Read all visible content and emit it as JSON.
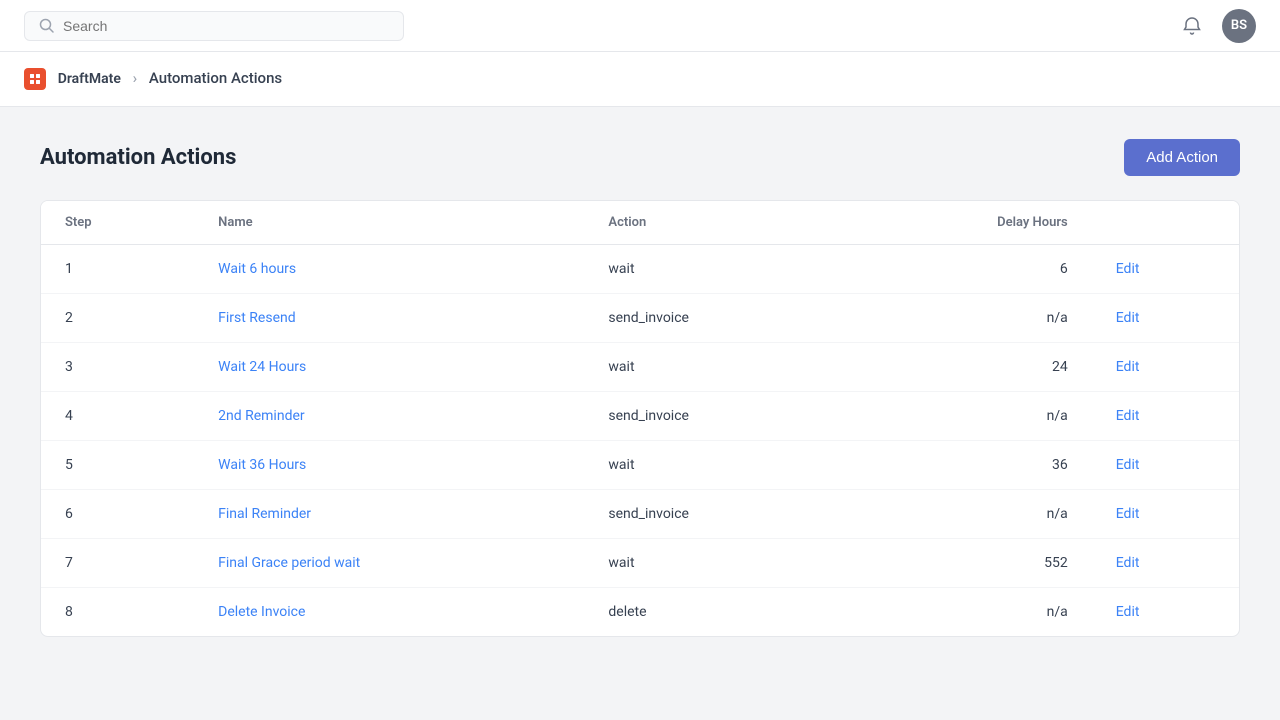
{
  "app": {
    "name": "DraftMate"
  },
  "nav": {
    "search_placeholder": "Search",
    "avatar_initials": "BS"
  },
  "breadcrumb": {
    "title": "Automation Actions"
  },
  "page": {
    "title": "Automation Actions",
    "add_button_label": "Add Action"
  },
  "table": {
    "columns": [
      {
        "key": "step",
        "label": "Step",
        "align": "left"
      },
      {
        "key": "name",
        "label": "Name",
        "align": "left"
      },
      {
        "key": "action",
        "label": "Action",
        "align": "left"
      },
      {
        "key": "delay_hours",
        "label": "Delay Hours",
        "align": "right"
      }
    ],
    "rows": [
      {
        "step": "1",
        "name": "Wait 6 hours",
        "action": "wait",
        "delay_hours": "6",
        "edit_label": "Edit"
      },
      {
        "step": "2",
        "name": "First Resend",
        "action": "send_invoice",
        "delay_hours": "n/a",
        "edit_label": "Edit"
      },
      {
        "step": "3",
        "name": "Wait 24 Hours",
        "action": "wait",
        "delay_hours": "24",
        "edit_label": "Edit"
      },
      {
        "step": "4",
        "name": "2nd Reminder",
        "action": "send_invoice",
        "delay_hours": "n/a",
        "edit_label": "Edit"
      },
      {
        "step": "5",
        "name": "Wait 36 Hours",
        "action": "wait",
        "delay_hours": "36",
        "edit_label": "Edit"
      },
      {
        "step": "6",
        "name": "Final Reminder",
        "action": "send_invoice",
        "delay_hours": "n/a",
        "edit_label": "Edit"
      },
      {
        "step": "7",
        "name": "Final Grace period wait",
        "action": "wait",
        "delay_hours": "552",
        "edit_label": "Edit"
      },
      {
        "step": "8",
        "name": "Delete Invoice",
        "action": "delete",
        "delay_hours": "n/a",
        "edit_label": "Edit"
      }
    ]
  }
}
